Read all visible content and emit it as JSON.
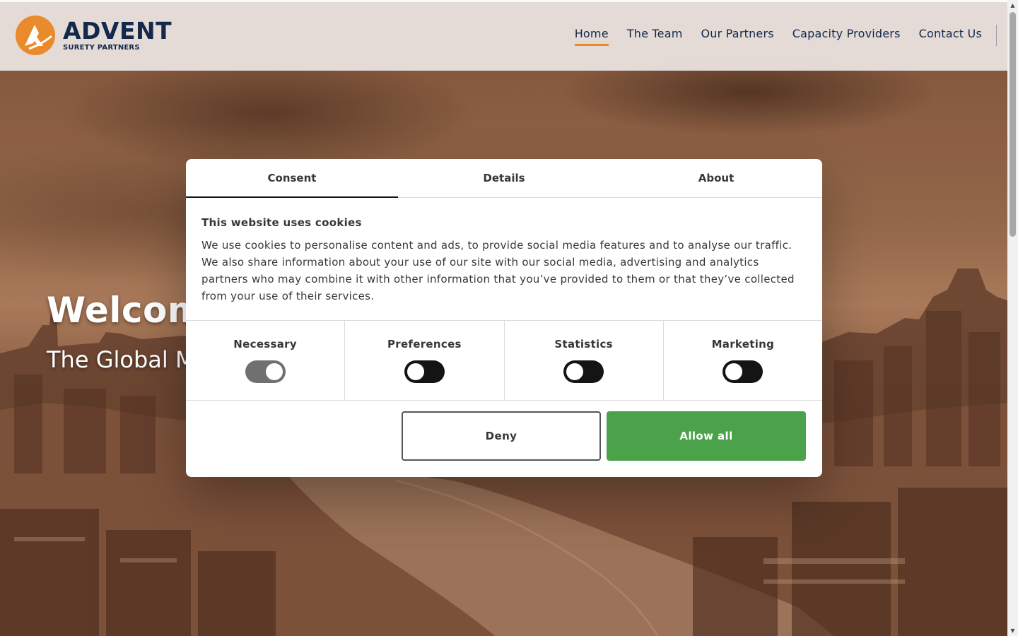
{
  "brand": {
    "name": "ADVENT",
    "tagline": "SURETY PARTNERS",
    "accent": "#e98a2c",
    "navy": "#13294b"
  },
  "nav": {
    "items": [
      {
        "label": "Home",
        "active": true
      },
      {
        "label": "The Team"
      },
      {
        "label": "Our Partners"
      },
      {
        "label": "Capacity Providers"
      },
      {
        "label": "Contact Us"
      }
    ]
  },
  "hero": {
    "title": "Welcom",
    "subtitle": "The Global M"
  },
  "cookie_dialog": {
    "tabs": [
      {
        "label": "Consent",
        "active": true
      },
      {
        "label": "Details"
      },
      {
        "label": "About"
      }
    ],
    "heading": "This website uses cookies",
    "body": "We use cookies to personalise content and ads, to provide social media features and to analyse our traffic. We also share information about your use of our site with our social media, advertising and analytics partners who may combine it with other information that you’ve provided to them or that they’ve collected from your use of their services.",
    "categories": [
      {
        "label": "Necessary",
        "enabled": true
      },
      {
        "label": "Preferences",
        "enabled": false
      },
      {
        "label": "Statistics",
        "enabled": false
      },
      {
        "label": "Marketing",
        "enabled": false
      }
    ],
    "deny_label": "Deny",
    "allow_label": "Allow all",
    "allow_color": "#4ba24a"
  },
  "icons": {
    "logo": "advent-logo-icon",
    "scroll_up": "▲",
    "scroll_down": "▼"
  }
}
